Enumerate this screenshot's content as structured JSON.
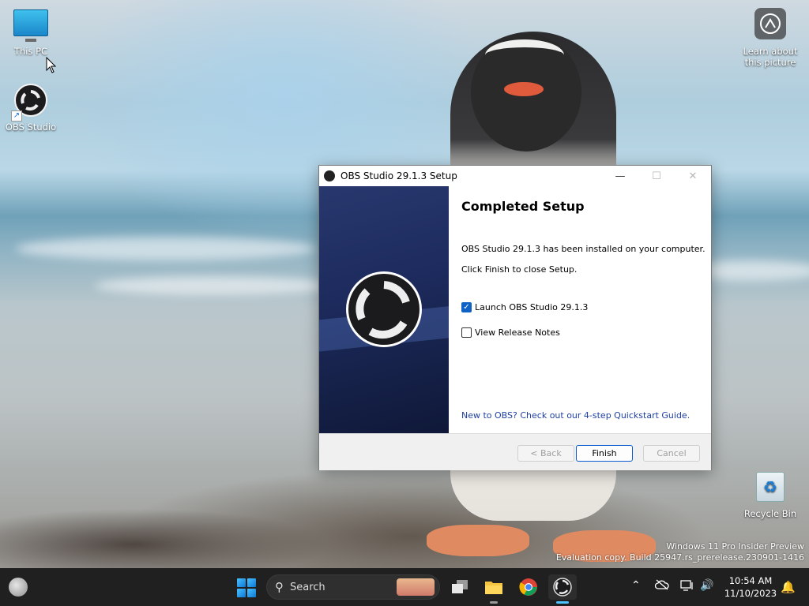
{
  "desktop": {
    "icons": [
      {
        "label": "This PC"
      },
      {
        "label": "OBS Studio"
      }
    ],
    "learn_label": "Learn about this picture",
    "recycle_label": "Recycle Bin",
    "watermark_line1": "Windows 11 Pro Insider Preview",
    "watermark_line2": "Evaluation copy. Build 25947.rs_prerelease.230901-1416"
  },
  "window": {
    "title": "OBS Studio 29.1.3 Setup",
    "heading": "Completed Setup",
    "installed_text": "OBS Studio 29.1.3 has been installed on your computer.",
    "finish_hint": "Click Finish to close Setup.",
    "launch_label": "Launch OBS Studio 29.1.3",
    "launch_checked": true,
    "notes_label": "View Release Notes",
    "notes_checked": false,
    "quickstart_link": "New to OBS? Check out our 4-step Quickstart Guide.",
    "buttons": {
      "back": "< Back",
      "finish": "Finish",
      "cancel": "Cancel"
    }
  },
  "taskbar": {
    "search_label": "Search",
    "time": "10:54 AM",
    "date": "11/10/2023"
  },
  "colors": {
    "accent": "#0f62c5",
    "link": "#1e3fa0",
    "taskbar": "#202020"
  }
}
